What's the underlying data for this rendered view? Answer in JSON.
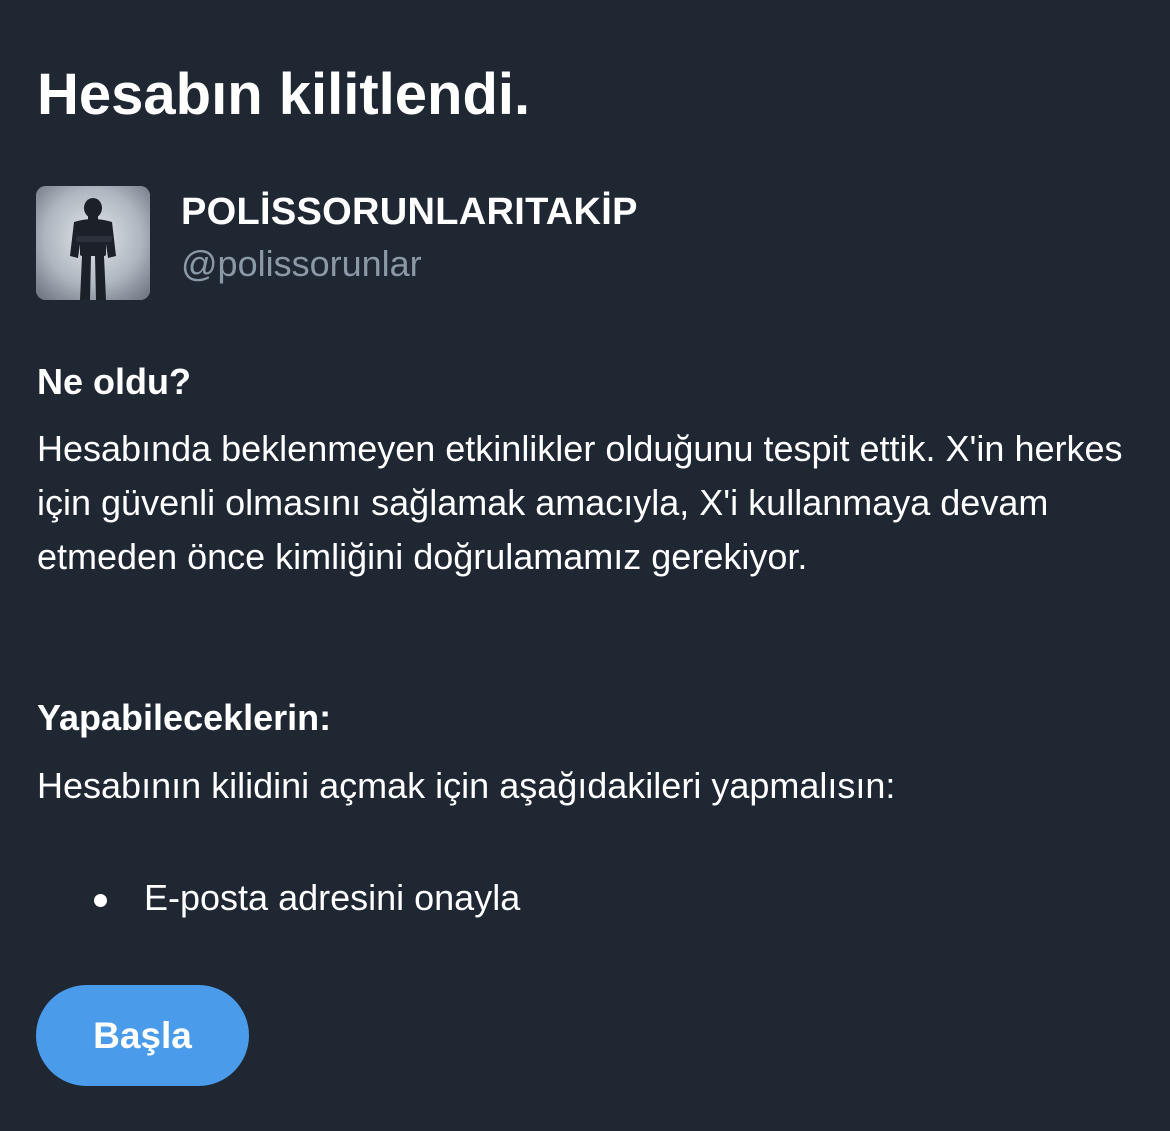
{
  "page": {
    "title": "Hesabın kilitlendi."
  },
  "account": {
    "display_name": "POLİSSORUNLARITAKİP",
    "handle": "@polissorunlar",
    "avatar_icon": "soldier-silhouette-icon"
  },
  "what_happened": {
    "heading": "Ne oldu?",
    "text": "Hesabında beklenmeyen etkinlikler olduğunu tespit ettik. X'in herkes için güvenli olmasını sağlamak amacıyla, X'i kullanmaya devam etmeden önce kimliğini doğrulamamız gerekiyor."
  },
  "what_you_can_do": {
    "heading": "Yapabileceklerin:",
    "text": "Hesabının kilidini açmak için aşağıdakileri yapmalısın:",
    "steps": [
      {
        "label": "E-posta adresini onayla"
      }
    ]
  },
  "actions": {
    "start_label": "Başla"
  },
  "colors": {
    "background": "#1f2733",
    "text": "#ffffff",
    "secondary_text": "#8b98a5",
    "accent": "#4a9cea"
  }
}
